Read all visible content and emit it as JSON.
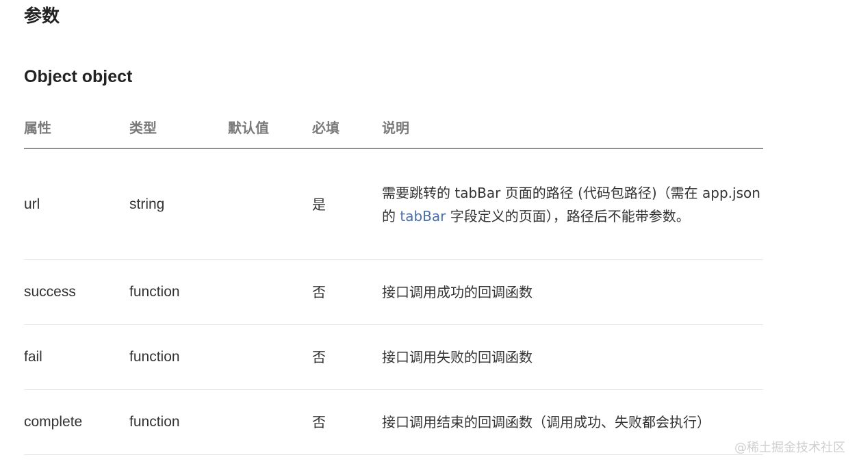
{
  "page": {
    "section_title": "参数",
    "sub_title": "Object object"
  },
  "table": {
    "headers": [
      "属性",
      "类型",
      "默认值",
      "必填",
      "说明"
    ],
    "rows": [
      {
        "name": "url",
        "type": "string",
        "default": "",
        "required": "是",
        "desc_part1": "需要跳转的 tabBar 页面的路径 (代码包路径)（需在 app.json 的 ",
        "desc_link": "tabBar",
        "desc_part2": " 字段定义的页面），路径后不能带参数。"
      },
      {
        "name": "success",
        "type": "function",
        "default": "",
        "required": "否",
        "desc": "接口调用成功的回调函数"
      },
      {
        "name": "fail",
        "type": "function",
        "default": "",
        "required": "否",
        "desc": "接口调用失败的回调函数"
      },
      {
        "name": "complete",
        "type": "function",
        "default": "",
        "required": "否",
        "desc": "接口调用结束的回调函数（调用成功、失败都会执行）"
      }
    ]
  },
  "watermark": "@稀土掘金技术社区"
}
